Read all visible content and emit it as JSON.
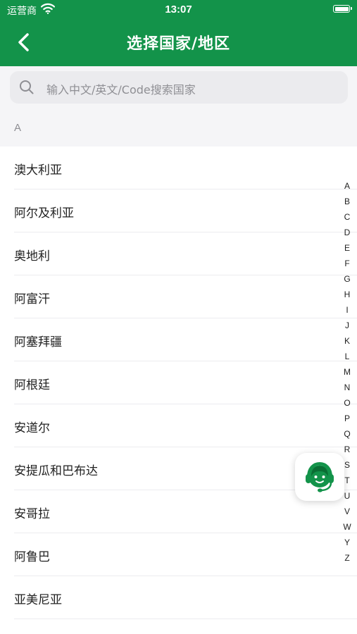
{
  "status_bar": {
    "carrier": "运营商",
    "time": "13:07"
  },
  "nav": {
    "title": "选择国家/地区"
  },
  "search": {
    "placeholder": "输入中文/英文/Code搜索国家"
  },
  "section": {
    "label": "A"
  },
  "countries": [
    "澳大利亚",
    "阿尔及利亚",
    "奥地利",
    "阿富汗",
    "阿塞拜疆",
    "阿根廷",
    "安道尔",
    "安提瓜和巴布达",
    "安哥拉",
    "阿鲁巴",
    "亚美尼亚"
  ],
  "index": [
    "A",
    "B",
    "C",
    "D",
    "E",
    "F",
    "G",
    "H",
    "I",
    "J",
    "K",
    "L",
    "M",
    "N",
    "O",
    "P",
    "Q",
    "R",
    "S",
    "T",
    "U",
    "V",
    "W",
    "Y",
    "Z"
  ],
  "colors": {
    "brand_green": "#13934a",
    "background": "#f5f5f7"
  },
  "icons": {
    "back": "chevron-left-icon",
    "search": "magnifier-icon",
    "support": "customer-service-headset-icon"
  }
}
